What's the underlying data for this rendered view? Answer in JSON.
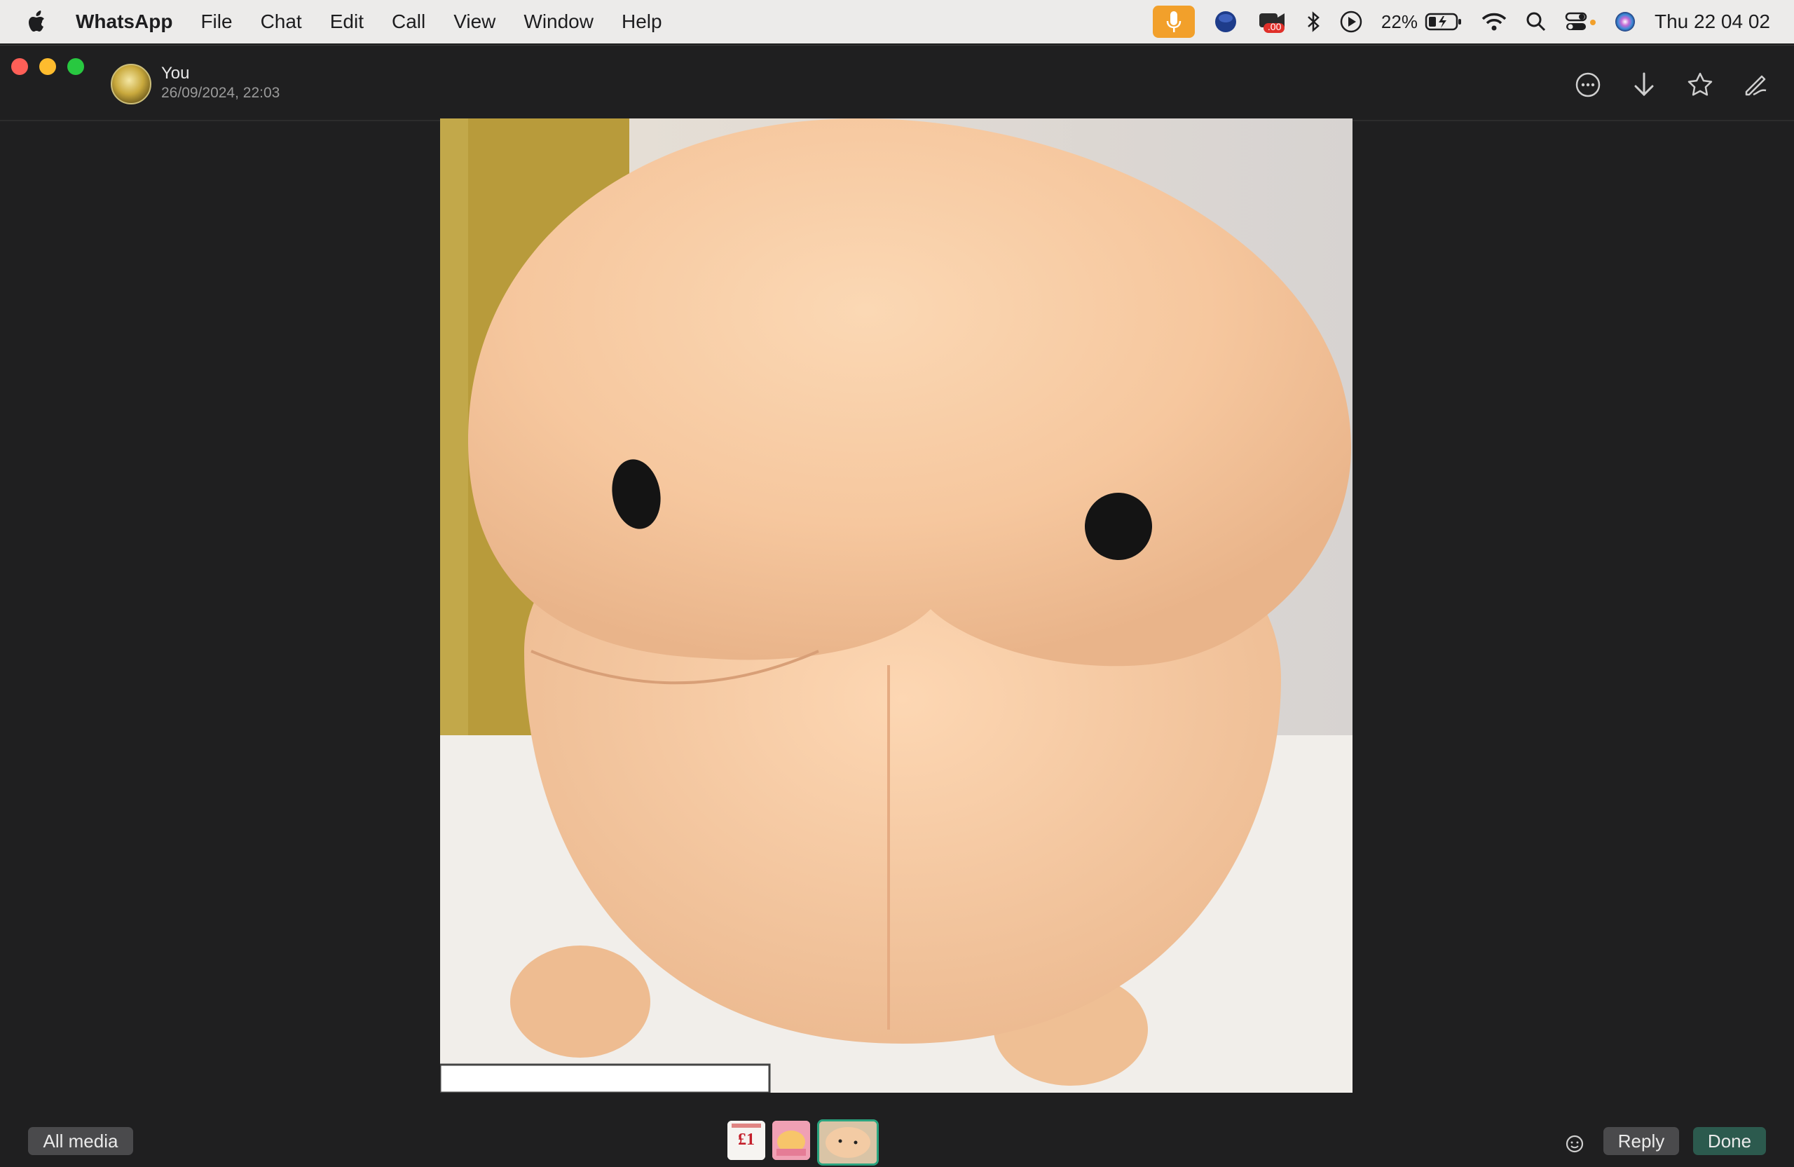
{
  "menubar": {
    "app_name": "WhatsApp",
    "items": [
      "File",
      "Chat",
      "Edit",
      "Call",
      "View",
      "Window",
      "Help"
    ],
    "battery_percent": "22%",
    "clock": "Thu 22 04 02",
    "red_badge": ".00"
  },
  "window": {
    "sender": "You",
    "timestamp": "26/09/2024, 22:03"
  },
  "thumbnails": {
    "first_label": "£1"
  },
  "bottombar": {
    "all_media_label": "All media",
    "reply_label": "Reply",
    "done_label": "Done"
  },
  "colors": {
    "accent_done": "#2c5a4e",
    "thumb_selected_border": "#2aa47f",
    "mic_pill": "#f2a02b"
  }
}
